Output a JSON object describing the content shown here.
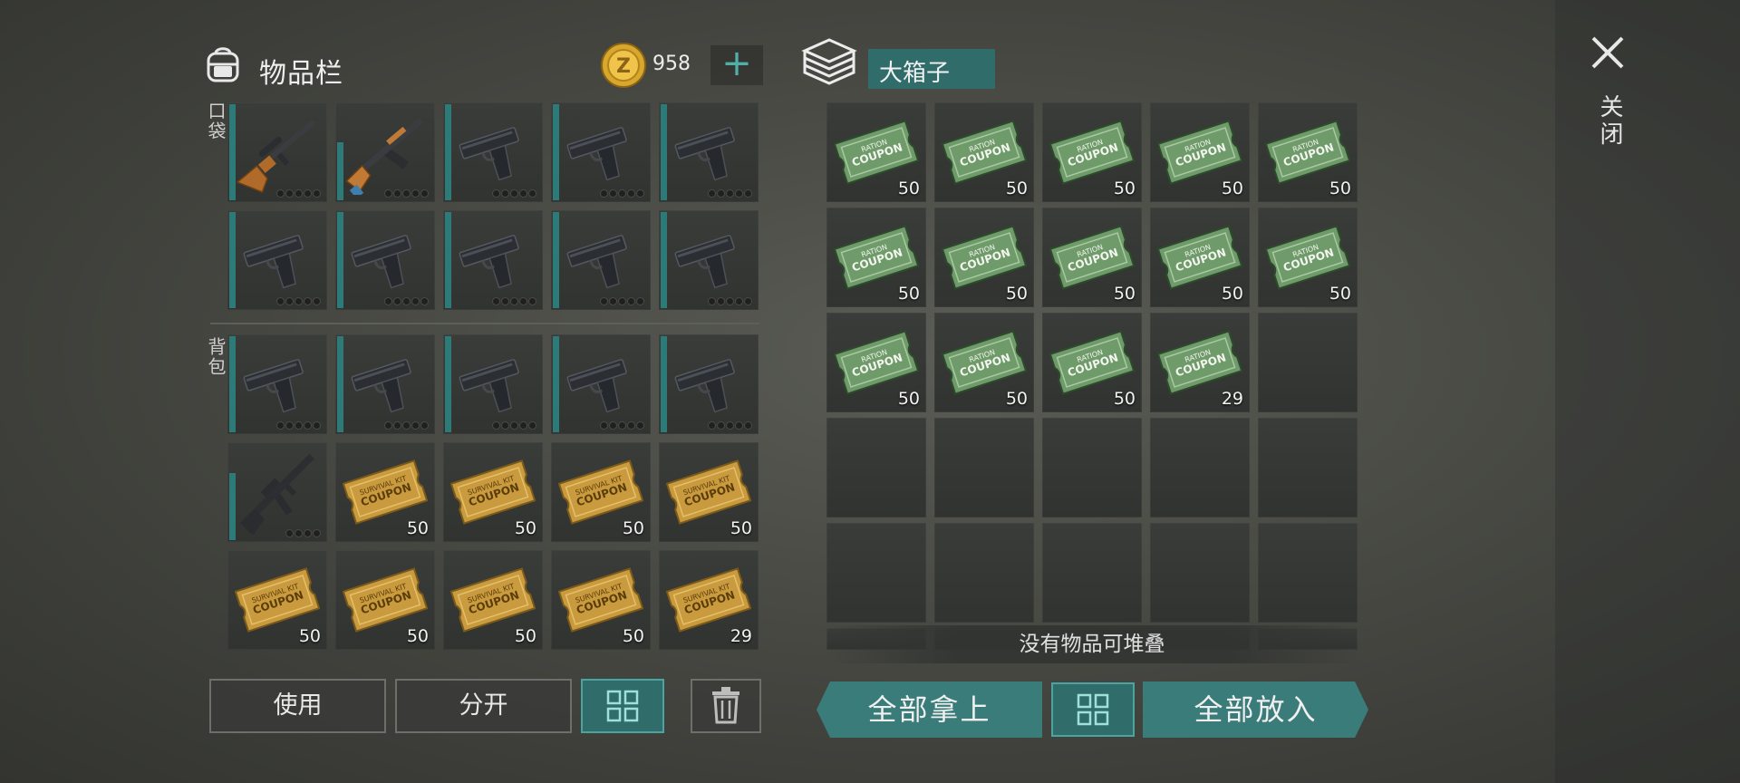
{
  "inventory": {
    "title": "物品栏",
    "currency_icon": "z-coin-icon",
    "currency": "958",
    "add_label": "+",
    "pocket_label": "口袋",
    "backpack_label": "背包",
    "pocket_slots": [
      {
        "item": "sniper-rifle-icon",
        "dots": 5,
        "durability": 1.0
      },
      {
        "item": "ak-rifle-icon",
        "dots": 5,
        "durability": 0.6
      },
      {
        "item": "pistol-icon",
        "dots": 5,
        "durability": 1.0
      },
      {
        "item": "pistol-icon",
        "dots": 5,
        "durability": 1.0
      },
      {
        "item": "pistol-icon",
        "dots": 5,
        "durability": 1.0
      },
      {
        "item": "pistol-icon",
        "dots": 5,
        "durability": 1.0
      },
      {
        "item": "pistol-icon",
        "dots": 5,
        "durability": 1.0
      },
      {
        "item": "pistol-icon",
        "dots": 5,
        "durability": 1.0
      },
      {
        "item": "pistol-icon",
        "dots": 5,
        "durability": 1.0
      },
      {
        "item": "pistol-icon",
        "dots": 5,
        "durability": 1.0
      }
    ],
    "backpack_slots": [
      {
        "item": "pistol-icon",
        "dots": 5,
        "durability": 1.0
      },
      {
        "item": "pistol-icon",
        "dots": 5,
        "durability": 1.0
      },
      {
        "item": "pistol-icon",
        "dots": 5,
        "durability": 1.0
      },
      {
        "item": "pistol-icon",
        "dots": 5,
        "durability": 1.0
      },
      {
        "item": "pistol-icon",
        "dots": 5,
        "durability": 1.0
      },
      {
        "item": "m16-rifle-icon",
        "dots": 4,
        "durability": 0.7
      },
      {
        "item": "survival-kit-coupon-icon",
        "qty": "50"
      },
      {
        "item": "survival-kit-coupon-icon",
        "qty": "50"
      },
      {
        "item": "survival-kit-coupon-icon",
        "qty": "50"
      },
      {
        "item": "survival-kit-coupon-icon",
        "qty": "50"
      },
      {
        "item": "survival-kit-coupon-icon",
        "qty": "50"
      },
      {
        "item": "survival-kit-coupon-icon",
        "qty": "50"
      },
      {
        "item": "survival-kit-coupon-icon",
        "qty": "50"
      },
      {
        "item": "survival-kit-coupon-icon",
        "qty": "50"
      },
      {
        "item": "survival-kit-coupon-icon",
        "qty": "29"
      }
    ]
  },
  "container": {
    "title": "大箱子",
    "slots": [
      {
        "item": "ration-coupon-icon",
        "qty": "50"
      },
      {
        "item": "ration-coupon-icon",
        "qty": "50"
      },
      {
        "item": "ration-coupon-icon",
        "qty": "50"
      },
      {
        "item": "ration-coupon-icon",
        "qty": "50"
      },
      {
        "item": "ration-coupon-icon",
        "qty": "50"
      },
      {
        "item": "ration-coupon-icon",
        "qty": "50"
      },
      {
        "item": "ration-coupon-icon",
        "qty": "50"
      },
      {
        "item": "ration-coupon-icon",
        "qty": "50"
      },
      {
        "item": "ration-coupon-icon",
        "qty": "50"
      },
      {
        "item": "ration-coupon-icon",
        "qty": "50"
      },
      {
        "item": "ration-coupon-icon",
        "qty": "50"
      },
      {
        "item": "ration-coupon-icon",
        "qty": "50"
      },
      {
        "item": "ration-coupon-icon",
        "qty": "50"
      },
      {
        "item": "ration-coupon-icon",
        "qty": "29"
      },
      {
        "item": "empty"
      },
      {
        "item": "empty"
      },
      {
        "item": "empty"
      },
      {
        "item": "empty"
      },
      {
        "item": "empty"
      },
      {
        "item": "empty"
      },
      {
        "item": "empty"
      },
      {
        "item": "empty"
      },
      {
        "item": "empty"
      },
      {
        "item": "empty"
      },
      {
        "item": "empty"
      }
    ],
    "stack_message": "没有物品可堆叠"
  },
  "ration_coupon_text": {
    "line1": "RATION",
    "line2": "COUPON"
  },
  "survival_coupon_text": {
    "line1": "SURVIVAL KIT",
    "line2": "COUPON"
  },
  "buttons": {
    "use": "使用",
    "split": "分开",
    "take_all": "全部拿上",
    "put_all": "全部放入"
  },
  "close_label": "关闭",
  "colors": {
    "accent_teal": "#3a7c79",
    "durability": "#2c7b78",
    "ration_green": "#6f9a6a",
    "survival_gold": "#c99a3e"
  }
}
